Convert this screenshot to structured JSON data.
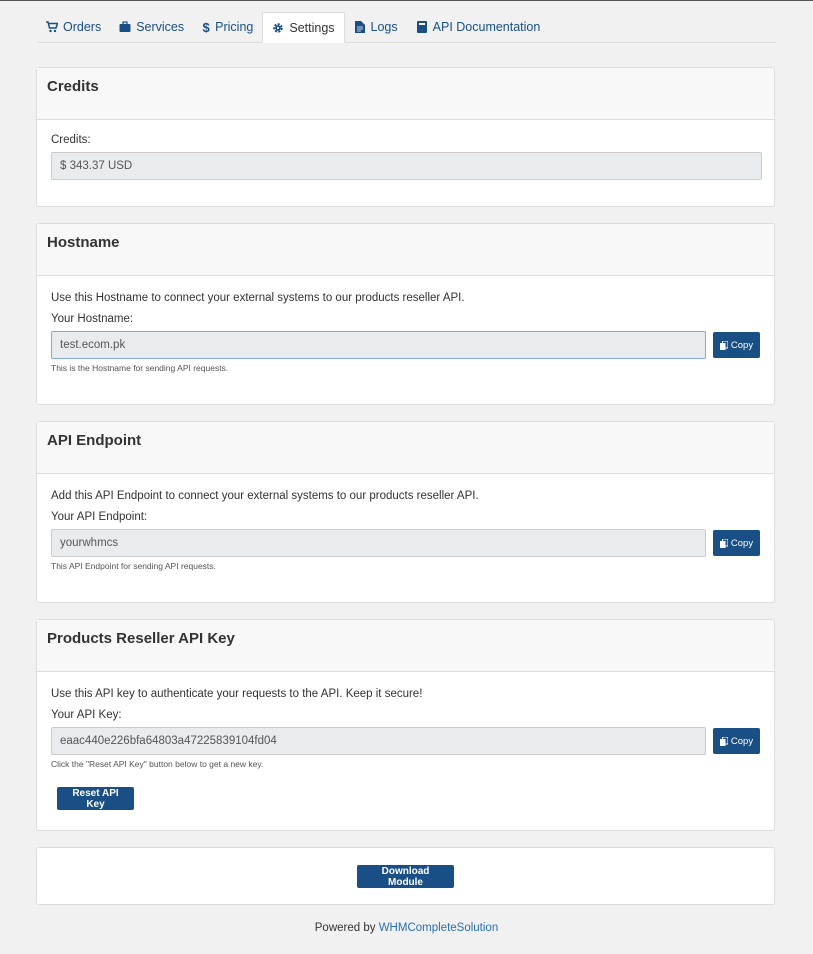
{
  "tabs": [
    {
      "label": "Orders",
      "icon": "cart-icon"
    },
    {
      "label": "Services",
      "icon": "briefcase-icon"
    },
    {
      "label": "Pricing",
      "icon": "dollar-icon"
    },
    {
      "label": "Settings",
      "icon": "gear-icon",
      "active": true
    },
    {
      "label": "Logs",
      "icon": "file-icon"
    },
    {
      "label": "API Documentation",
      "icon": "book-icon"
    }
  ],
  "credits": {
    "title": "Credits",
    "label": "Credits:",
    "value": "$ 343.37  USD"
  },
  "hostname": {
    "title": "Hostname",
    "description": "Use this Hostname to connect your external systems to our products reseller API.",
    "label": "Your Hostname:",
    "value": "test.ecom.pk",
    "help": "This is the Hostname for sending API requests.",
    "copy_label": "Copy"
  },
  "endpoint": {
    "title": "API Endpoint",
    "description": "Add this API Endpoint to connect your external systems to our products reseller API.",
    "label": "Your API Endpoint:",
    "value": "yourwhmcs",
    "help": "This API Endpoint for sending API requests.",
    "copy_label": "Copy"
  },
  "apikey": {
    "title": "Products Reseller API Key",
    "description": "Use this API key to authenticate your requests to the API. Keep it secure!",
    "label": "Your API Key:",
    "value": "eaac440e226bfa64803a47225839104fd04",
    "help": "Click the \"Reset API Key\" button below to get a new key.",
    "copy_label": "Copy",
    "reset_label": "Reset API Key"
  },
  "download": {
    "label": "Download Module"
  },
  "footer": {
    "prefix": "Powered by ",
    "link": "WHMCompleteSolution"
  },
  "colors": {
    "primary": "#1a4f86",
    "link": "#2a6fb0",
    "background": "#f1f1f1"
  }
}
